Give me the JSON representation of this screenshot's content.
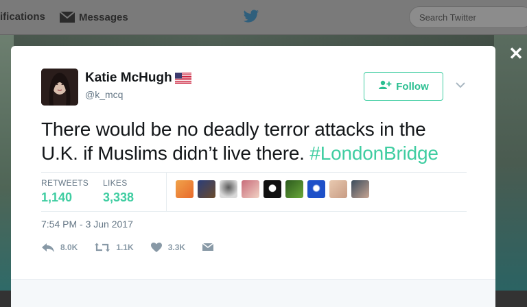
{
  "nav": {
    "notifications_label": "ifications",
    "messages_label": "Messages",
    "search_placeholder": "Search Twitter"
  },
  "tweet": {
    "display_name": "Katie McHugh",
    "handle": "@k_mcq",
    "text_main": "There would be no deadly terror attacks in the U.K. if Muslims didn’t live there. ",
    "hashtag": "#LondonBridge",
    "timestamp": "7:54 PM - 3 Jun 2017"
  },
  "follow_button": {
    "label": "Follow"
  },
  "stats": {
    "retweets_label": "RETWEETS",
    "retweets_value": "1,140",
    "likes_label": "LIKES",
    "likes_value": "3,338"
  },
  "actions": {
    "reply_count": "8.0K",
    "retweet_count": "1.1K",
    "like_count": "3.3K"
  },
  "colors": {
    "accent": "#3fcda1",
    "text": "#14171a",
    "muted": "#657786"
  },
  "icons": [
    "envelope-icon",
    "twitter-bird-icon",
    "close-icon",
    "follow-user-icon",
    "chevron-down-icon",
    "reply-icon",
    "retweet-icon",
    "heart-icon",
    "direct-message-icon",
    "us-flag-icon"
  ]
}
